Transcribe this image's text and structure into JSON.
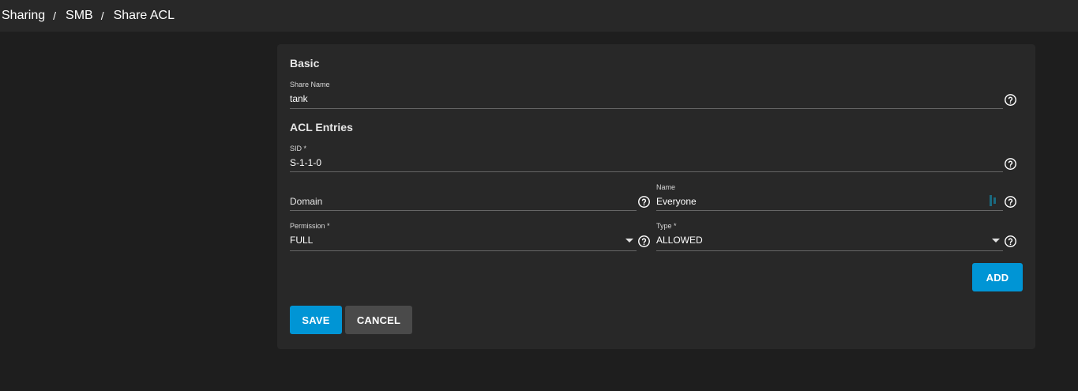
{
  "breadcrumb": {
    "items": [
      "Sharing",
      "SMB",
      "Share ACL"
    ],
    "separator": "/"
  },
  "basic": {
    "title": "Basic",
    "share_name": {
      "label": "Share Name",
      "value": "tank"
    }
  },
  "acl": {
    "title": "ACL Entries",
    "sid": {
      "label": "SID *",
      "value": "S-1-1-0"
    },
    "domain": {
      "placeholder": "Domain",
      "value": ""
    },
    "name": {
      "label": "Name",
      "value": "Everyone"
    },
    "permission": {
      "label": "Permission *",
      "value": "FULL"
    },
    "type": {
      "label": "Type *",
      "value": "ALLOWED"
    },
    "add_label": "ADD"
  },
  "actions": {
    "save_label": "SAVE",
    "cancel_label": "CANCEL"
  },
  "icons": {
    "help": "help-circle-icon",
    "dropdown": "chevron-down-icon",
    "combobox": "combobox-icon"
  },
  "colors": {
    "accent": "#0095d5",
    "background": "#1e1e1e",
    "card": "#282828",
    "topbar": "#282828",
    "secondary_button": "#4a4a4a",
    "combobox_icon": "#1a6a80"
  }
}
